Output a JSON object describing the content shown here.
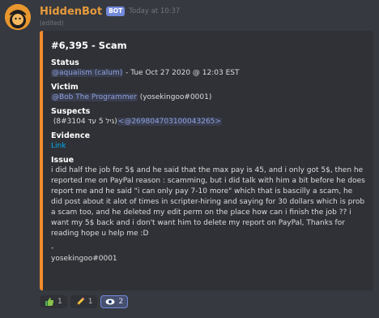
{
  "message": {
    "username": "HiddenBot",
    "bot_tag": "BOT",
    "timestamp": "Today at 10:37",
    "edited": "(edited)",
    "avatar_icon": "orange-character-avatar"
  },
  "embed": {
    "accent_color": "#f48c2c",
    "title": "#6,395 - Scam",
    "status": {
      "name": "Status",
      "mention": "@aquaiism (calum)",
      "text": " - Tue Oct 27 2020 @ 12:03 EST"
    },
    "victim": {
      "name": "Victim",
      "mention": "@Bob The Programmer",
      "text": " (yosekingoo#0001)"
    },
    "suspects": {
      "name": "Suspects",
      "text": "(גיל 5 עד 8#3104) ",
      "mention": "<@269804703100043265>"
    },
    "evidence": {
      "name": "Evidence",
      "link": "Link"
    },
    "issue": {
      "name": "Issue",
      "text": "i did half the job for 5$ and he said that the max pay is 45, and i only got 5$, then he reported me on PayPal reason : scamming, but i did talk with him a bit before he does report me and he said \"i can only pay 7-10 more\" which that is bascilly a scam, he did post about it alot of times in scripter-hiring and saying for 30 dollars which is prob a scam too, and he deleted my edit perm on the place how can i finish the job ?? i want my 5$ back and i don't want him to delete my report on PayPal, Thanks for reading hope u help me :D",
      "dash": "-",
      "signature": "yosekingoo#0001"
    }
  },
  "reactions": [
    {
      "icon": "thumbs-up-icon",
      "count": "1"
    },
    {
      "icon": "pencil-icon",
      "count": "1"
    },
    {
      "icon": "eye-icon",
      "count": "2"
    }
  ]
}
